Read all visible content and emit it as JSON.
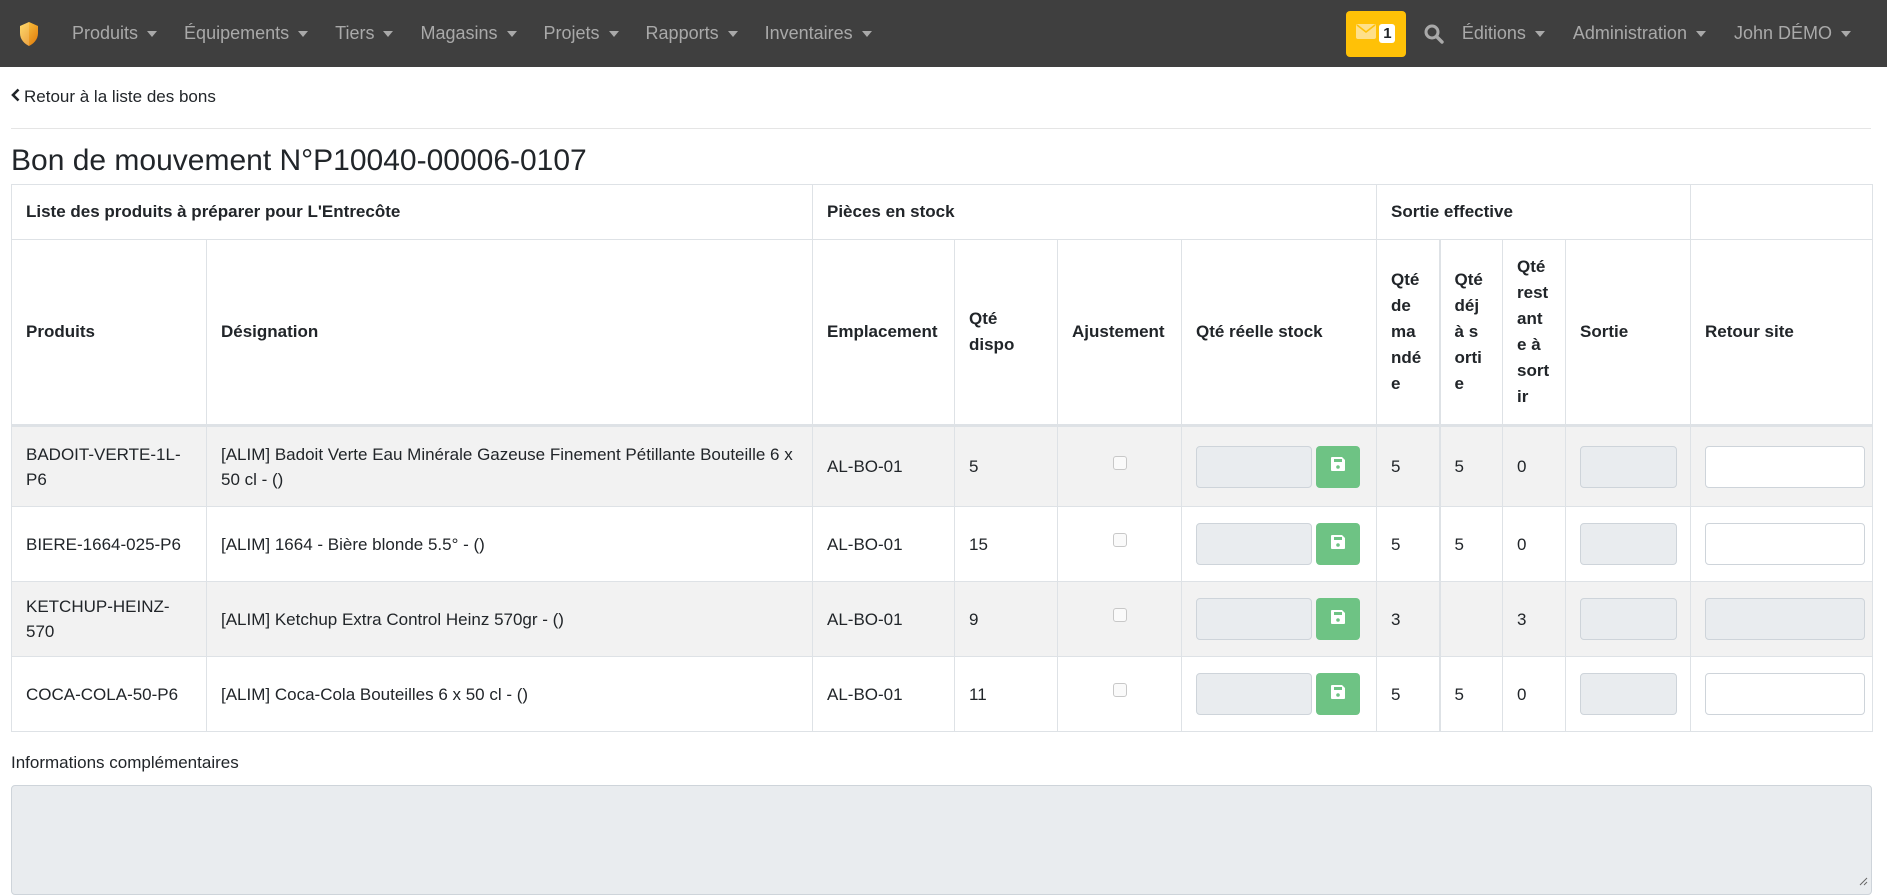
{
  "navbar": {
    "logo_icon": "shield-logo-icon",
    "menu": [
      {
        "label": "Produits"
      },
      {
        "label": "Équipements"
      },
      {
        "label": "Tiers"
      },
      {
        "label": "Magasins"
      },
      {
        "label": "Projets"
      },
      {
        "label": "Rapports"
      },
      {
        "label": "Inventaires"
      }
    ],
    "mail": {
      "icon": "envelope-icon",
      "count": "1",
      "color": "#ffc107"
    },
    "search_icon": "search-icon",
    "right_menu": [
      {
        "label": "Éditions"
      },
      {
        "label": "Administration"
      },
      {
        "label": "John DÉMO"
      }
    ]
  },
  "back_link": {
    "label": "Retour à la liste des bons",
    "icon": "chevron-left-icon"
  },
  "page_title": "Bon de mouvement N°P10040-00006-0107",
  "table": {
    "group_headers": {
      "products": "Liste des produits à préparer pour L'Entrecôte",
      "stock": "Pièces en stock",
      "exit": "Sortie effective",
      "extra": ""
    },
    "columns": {
      "produits": "Produits",
      "designation": "Désignation",
      "emplacement": "Emplacement",
      "qte_dispo": "Qté dispo",
      "ajustement": "Ajustement",
      "qte_reelle": "Qté réelle stock",
      "qte_demandee": "Qté demandée",
      "qte_deja_sortie": "Qté déjà sortie",
      "qte_restante": "Qté restante à sortir",
      "sortie": "Sortie",
      "retour_site": "Retour site"
    },
    "rows": [
      {
        "produit": "BADOIT-VERTE-1L-P6",
        "designation": "[ALIM] Badoit Verte Eau Minérale Gazeuse Finement Pétillante Bouteille 6 x 50 cl - ()",
        "emplacement": "AL-BO-01",
        "qte_dispo": "5",
        "ajustement_checked": false,
        "qte_reelle": "",
        "qte_demandee": "5",
        "qte_deja_sortie": "5",
        "qte_restante": "0",
        "sortie": "",
        "retour_site": "",
        "retour_disabled": false
      },
      {
        "produit": "BIERE-1664-025-P6",
        "designation": "[ALIM] 1664 - Bière blonde 5.5° - ()",
        "emplacement": "AL-BO-01",
        "qte_dispo": "15",
        "ajustement_checked": false,
        "qte_reelle": "",
        "qte_demandee": "5",
        "qte_deja_sortie": "5",
        "qte_restante": "0",
        "sortie": "",
        "retour_site": "",
        "retour_disabled": false
      },
      {
        "produit": "KETCHUP-HEINZ-570",
        "designation": "[ALIM] Ketchup Extra Control Heinz 570gr - ()",
        "emplacement": "AL-BO-01",
        "qte_dispo": "9",
        "ajustement_checked": false,
        "qte_reelle": "",
        "qte_demandee": "3",
        "qte_deja_sortie": "",
        "qte_restante": "3",
        "sortie": "",
        "retour_site": "",
        "retour_disabled": true
      },
      {
        "produit": "COCA-COLA-50-P6",
        "designation": "[ALIM] Coca-Cola Bouteilles 6 x 50 cl - ()",
        "emplacement": "AL-BO-01",
        "qte_dispo": "11",
        "ajustement_checked": false,
        "qte_reelle": "",
        "qte_demandee": "5",
        "qte_deja_sortie": "5",
        "qte_restante": "0",
        "sortie": "",
        "retour_site": "",
        "retour_disabled": false
      }
    ],
    "save_icon": "floppy-disk-icon",
    "save_button_color": "#6ec384"
  },
  "info": {
    "label": "Informations complémentaires",
    "value": ""
  }
}
